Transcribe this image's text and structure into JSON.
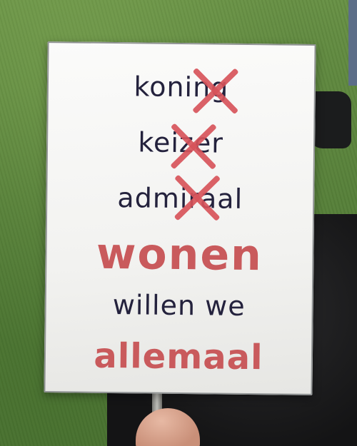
{
  "sign": {
    "struck_words": [
      "koning",
      "keizer",
      "admiraal"
    ],
    "line_wonen": "wonen",
    "line_willen": "willen we",
    "line_allemaal": "allemaal",
    "accent_color": "#c95a5c",
    "text_color": "#24223d",
    "strike_color": "#d7545a"
  }
}
